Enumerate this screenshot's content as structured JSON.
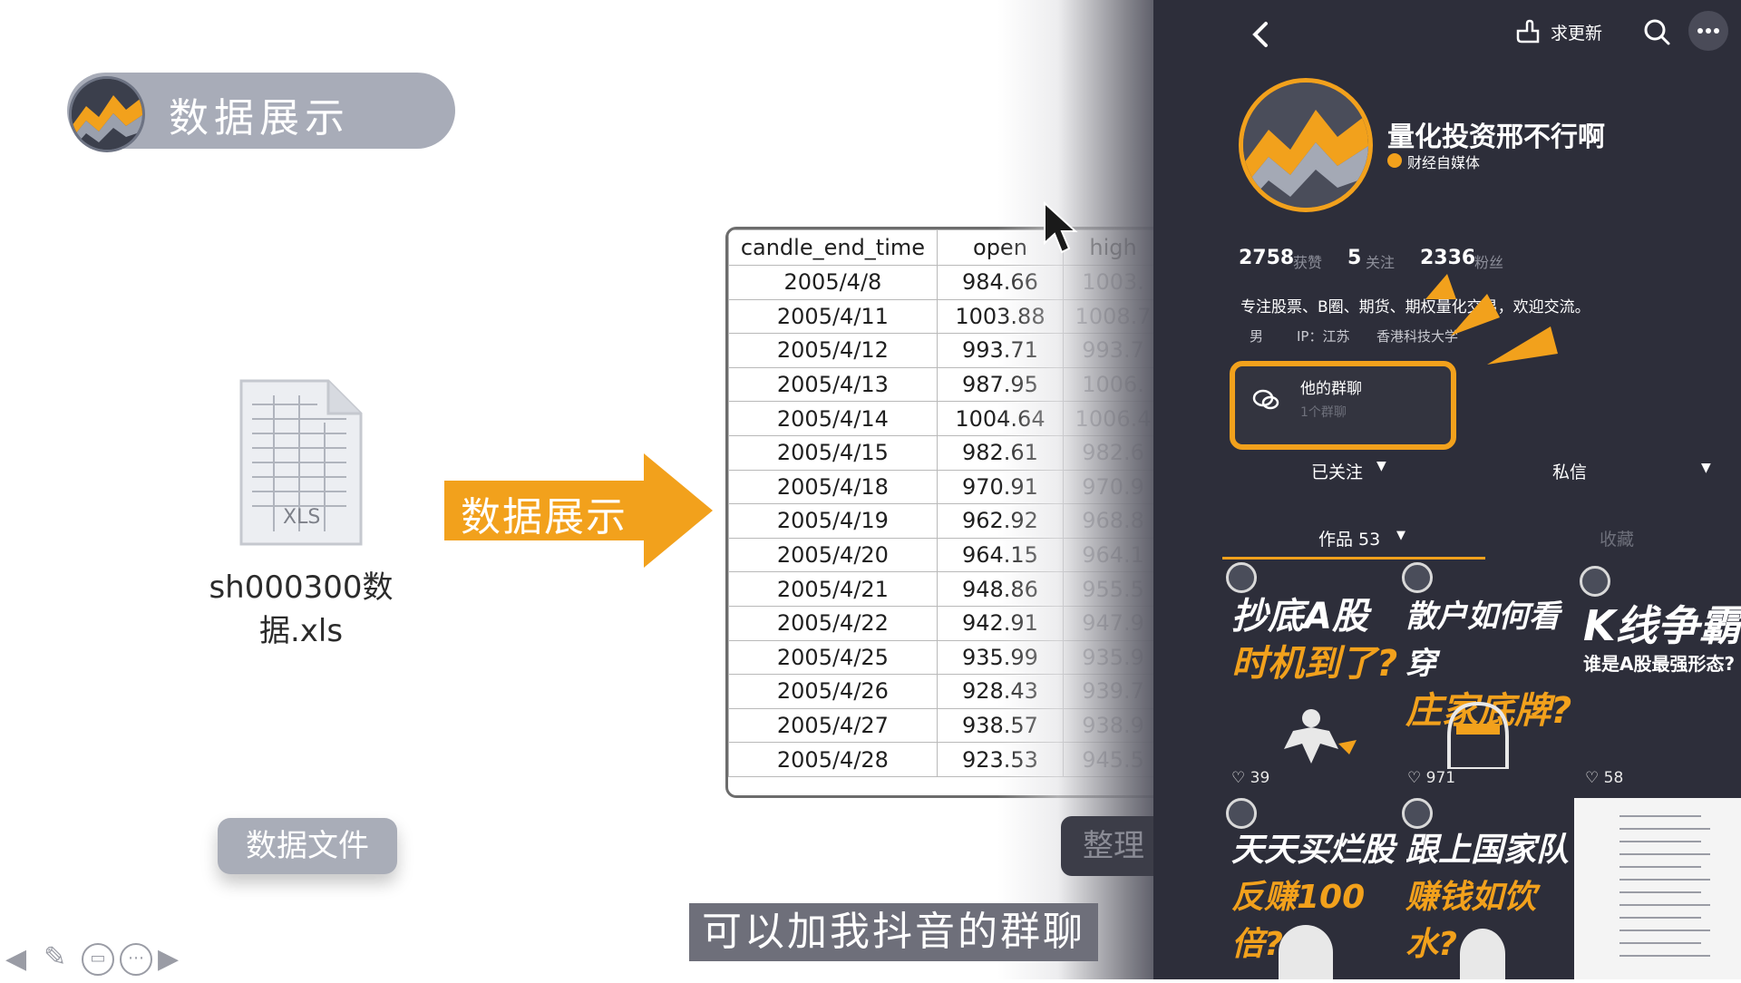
{
  "slide": {
    "title": "数据展示",
    "file_badge": "XLS",
    "file_name": "sh000300数据.xls",
    "data_file_button": "数据文件",
    "arrow_label": "数据展示",
    "partial_button": "整理",
    "subtitle": "可以加我抖音的群聊"
  },
  "table": {
    "headers": [
      "candle_end_time",
      "open",
      "high"
    ],
    "rows": [
      [
        "2005/4/8",
        "984.66",
        "1003."
      ],
      [
        "2005/4/11",
        "1003.88",
        "1008.7"
      ],
      [
        "2005/4/12",
        "993.71",
        "993.7"
      ],
      [
        "2005/4/13",
        "987.95",
        "1006."
      ],
      [
        "2005/4/14",
        "1004.64",
        "1006.4"
      ],
      [
        "2005/4/15",
        "982.61",
        "982.6"
      ],
      [
        "2005/4/18",
        "970.91",
        "970.9"
      ],
      [
        "2005/4/19",
        "962.92",
        "968.8"
      ],
      [
        "2005/4/20",
        "964.15",
        "964.1"
      ],
      [
        "2005/4/21",
        "948.86",
        "955.5"
      ],
      [
        "2005/4/22",
        "942.91",
        "947.9"
      ],
      [
        "2005/4/25",
        "935.99",
        "935.9"
      ],
      [
        "2005/4/26",
        "928.43",
        "939.7"
      ],
      [
        "2005/4/27",
        "938.57",
        "938.9"
      ],
      [
        "2005/4/28",
        "923.53",
        "945.5"
      ]
    ]
  },
  "profile": {
    "request_update": "求更新",
    "name": "量化投资邢不行啊",
    "verified": "财经自媒体",
    "likes_num": "2758",
    "likes_label": "获赞",
    "following_num": "5",
    "following_label": "关注",
    "fans_num": "2336",
    "fans_label": "粉丝",
    "bio": "专注股票、B圈、期货、期权量化交易，欢迎交流。",
    "gender": "男",
    "ip": "IP：江苏",
    "school": "香港科技大学",
    "group_chat": "他的群聊",
    "group_sub": "1个群聊",
    "followed": "已关注",
    "message": "私信",
    "works_tab": "作品 53",
    "collect_tab": "收藏"
  },
  "cards": [
    {
      "line1": "抄底A股",
      "line2": "时机到了?",
      "likes": "39"
    },
    {
      "line1": "散户如何看穿",
      "line2": "庄家底牌?",
      "likes": "971"
    },
    {
      "line1": "K线争霸",
      "line2": "谁是A股最强形态?",
      "likes": "58"
    },
    {
      "line1": "天天买烂股",
      "line2": "反赚100倍?"
    },
    {
      "line1": "跟上国家队",
      "line2": "赚钱如饮水?"
    }
  ],
  "colors": {
    "accent": "#f2a11c",
    "panel": "#2d2e3a",
    "pill": "#a8acb8"
  }
}
